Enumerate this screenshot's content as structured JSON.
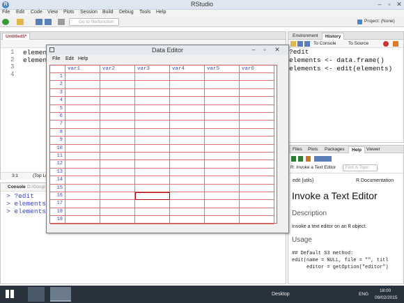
{
  "app": {
    "title": "RStudio"
  },
  "menu": [
    "File",
    "Edit",
    "Code",
    "View",
    "Plots",
    "Session",
    "Build",
    "Debug",
    "Tools",
    "Help"
  ],
  "toolbar": {
    "goto_placeholder": "Go to file/function",
    "project": "Project: (None)"
  },
  "editor": {
    "tab_label": "Untitled1*",
    "line_numbers": [
      "1",
      "2",
      "3",
      "4"
    ],
    "lines": [
      "elemen",
      "elemen",
      "",
      ""
    ],
    "status_pos": "3:1",
    "status_level": "(Top Le"
  },
  "console": {
    "tab_label": "Console",
    "path": "D:/Googl",
    "lines": [
      "> ?edit",
      "> elements",
      "> elements"
    ]
  },
  "history": {
    "tabs": [
      "Environment",
      "History"
    ],
    "to_console": "To Console",
    "to_source": "To Source",
    "lines": [
      "?edit",
      "elements <- data.frame()",
      "elements <- edit(elements)"
    ]
  },
  "help_pane": {
    "tabs": [
      "Files",
      "Plots",
      "Packages",
      "Help",
      "Viewer"
    ],
    "topic_select": "R: Invoke a Text Editor",
    "find_placeholder": "Find in Topic",
    "pkg": "edit {utils}",
    "doc_label": "R Documentation",
    "title": "Invoke a Text Editor",
    "description_heading": "Description",
    "description_text": "Invoke a text editor on an",
    "description_code": "R",
    "description_tail": "object.",
    "usage_heading": "Usage",
    "usage_code": [
      "## Default S3 method:",
      "edit(name = NULL, file = \"\", titl",
      "     editor = getOption(\"editor\")"
    ]
  },
  "data_editor": {
    "title": "Data Editor",
    "menu": [
      "File",
      "Edit",
      "Help"
    ],
    "columns": [
      "var1",
      "var2",
      "var3",
      "var4",
      "var5",
      "var6"
    ],
    "rows": [
      "1",
      "2",
      "3",
      "4",
      "5",
      "6",
      "7",
      "8",
      "9",
      "10",
      "11",
      "12",
      "13",
      "14",
      "15",
      "16",
      "17",
      "18",
      "19"
    ],
    "active_cell": {
      "row": "16",
      "column": "var3"
    }
  },
  "taskbar": {
    "desktop": "Desktop",
    "lang": "ENG",
    "time": "18:00",
    "date": "09/02/2015"
  },
  "colors": {
    "accent_blue": "#3f48c4",
    "grid_red": "#d97070",
    "taskbar": "#28323d"
  }
}
